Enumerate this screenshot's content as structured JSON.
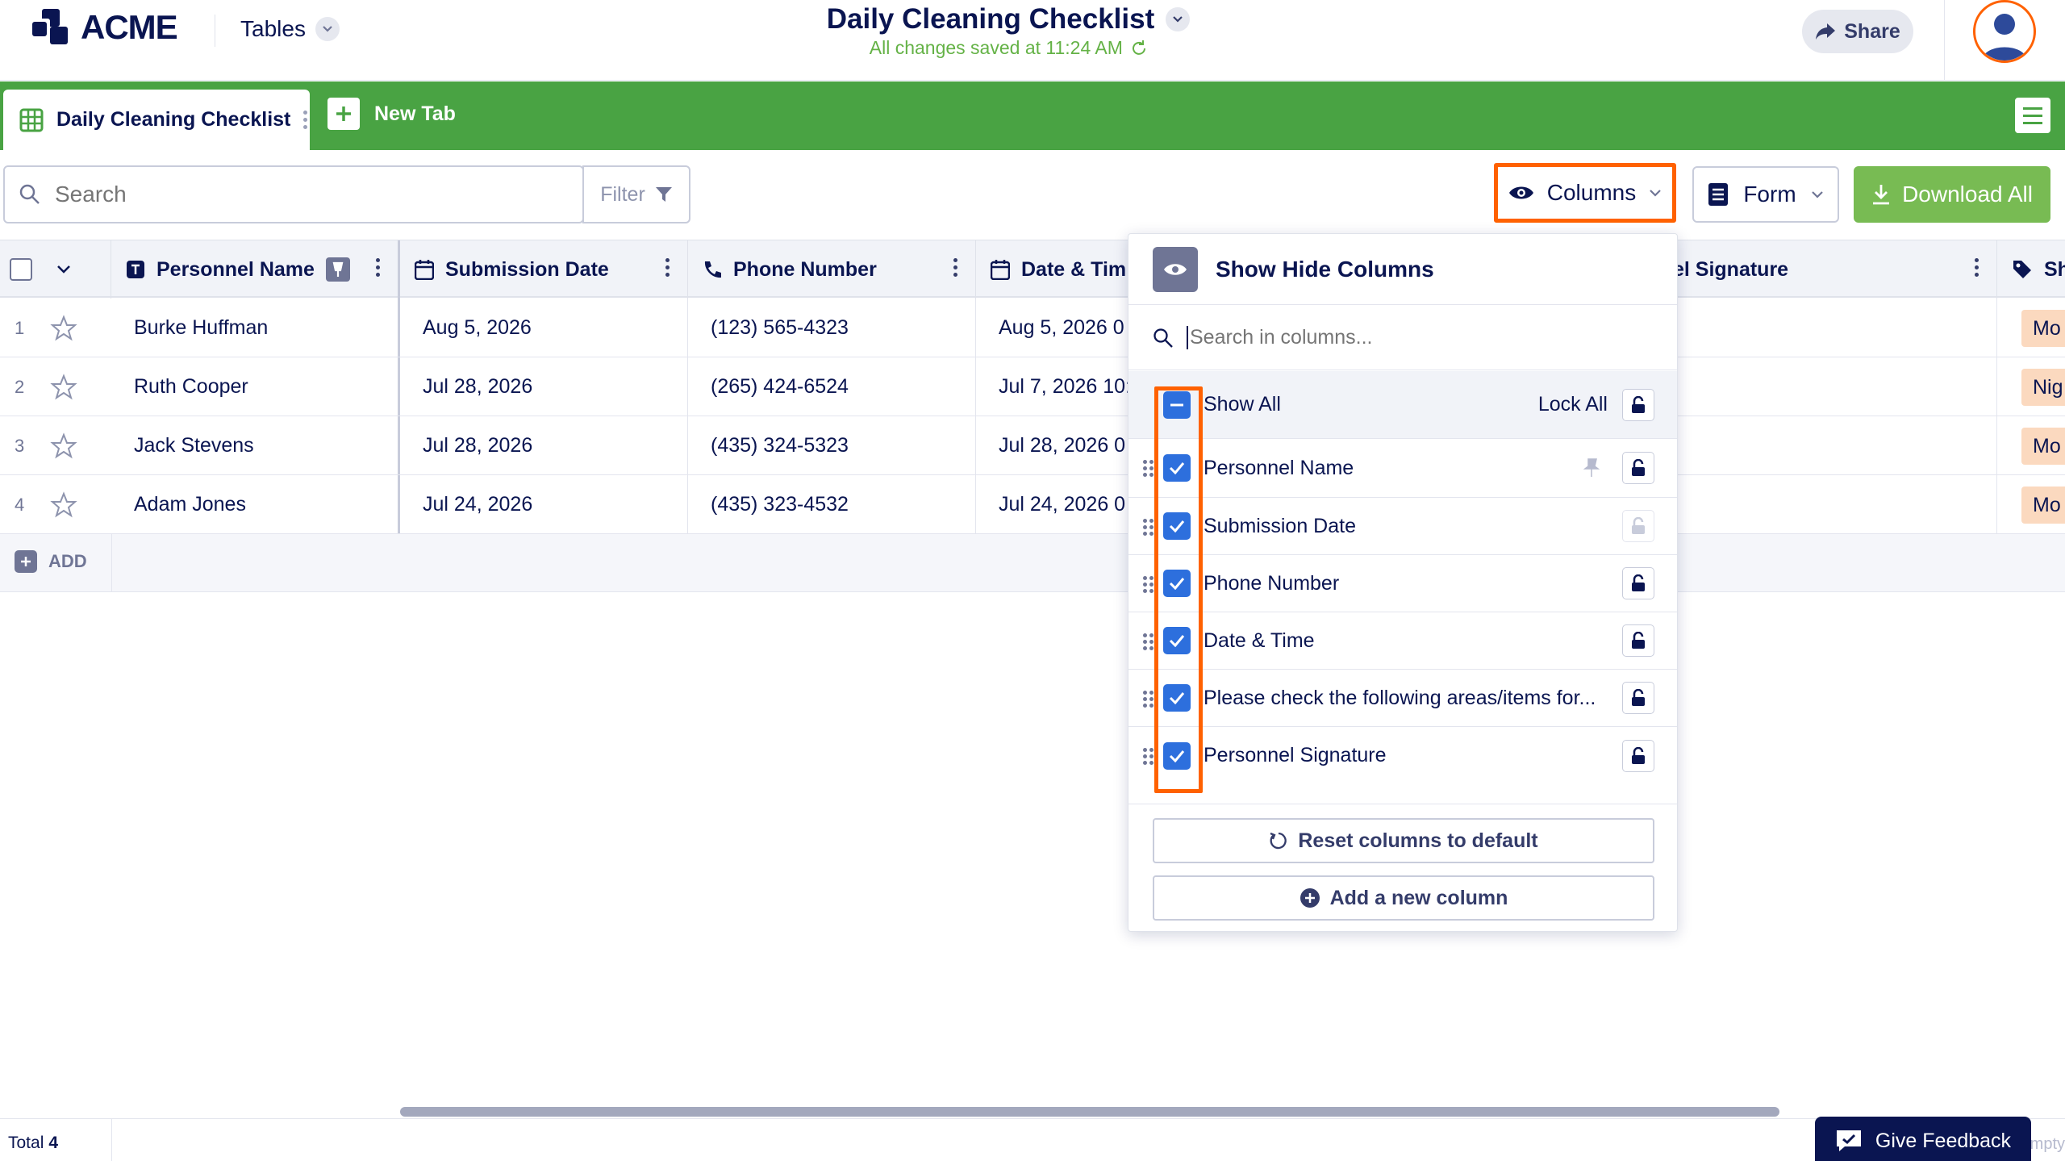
{
  "header": {
    "logo_text": "ACME",
    "tables_label": "Tables",
    "title": "Daily Cleaning Checklist",
    "saved_status": "All changes saved at 11:24 AM",
    "share_label": "Share"
  },
  "tabs": {
    "active_label": "Daily Cleaning Checklist",
    "new_tab_label": "New Tab"
  },
  "toolbar": {
    "search_placeholder": "Search",
    "filter_label": "Filter",
    "columns_label": "Columns",
    "form_label": "Form",
    "download_label": "Download All"
  },
  "table": {
    "columns": [
      "Personnel Name",
      "Submission Date",
      "Phone Number",
      "Date & Tim",
      "el Signature",
      "Sh"
    ],
    "rows": [
      {
        "num": "1",
        "name": "Burke Huffman",
        "submission": "Aug 5, 2026",
        "phone": "(123) 565-4323",
        "datetime": "Aug 5, 2026 0",
        "badge": "Mo"
      },
      {
        "num": "2",
        "name": "Ruth Cooper",
        "submission": "Jul 28, 2026",
        "phone": "(265) 424-6524",
        "datetime": "Jul 7, 2026 10:",
        "badge": "Nig"
      },
      {
        "num": "3",
        "name": "Jack Stevens",
        "submission": "Jul 28, 2026",
        "phone": "(435) 324-5323",
        "datetime": "Jul 28, 2026 0",
        "badge": "Mo"
      },
      {
        "num": "4",
        "name": "Adam Jones",
        "submission": "Jul 24, 2026",
        "phone": "(435) 323-4532",
        "datetime": "Jul 24, 2026 0",
        "badge": "Mo"
      }
    ],
    "add_label": "ADD"
  },
  "footer": {
    "total_label": "Total",
    "total_count": "4",
    "empty_text": "mpty",
    "feedback_label": "Give Feedback"
  },
  "popup": {
    "title": "Show Hide Columns",
    "search_placeholder": "Search in columns...",
    "show_all_label": "Show All",
    "lock_all_label": "Lock All",
    "items": [
      "Personnel Name",
      "Submission Date",
      "Phone Number",
      "Date & Time",
      "Please check the following areas/items for...",
      "Personnel Signature"
    ],
    "reset_label": "Reset columns to default",
    "add_column_label": "Add a new column"
  },
  "colors": {
    "brand_green": "#49a343",
    "download_green": "#78bb53",
    "highlight_orange": "#ff6100",
    "navy": "#0a1551",
    "checkbox_blue": "#2d6fdd"
  }
}
